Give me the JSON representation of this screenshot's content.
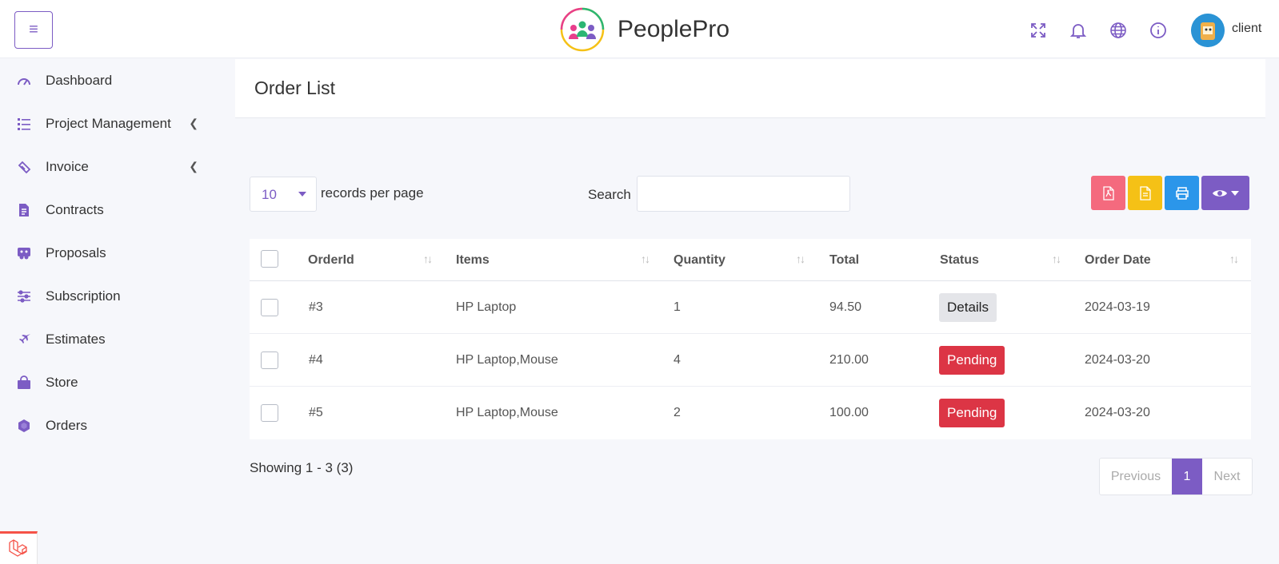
{
  "app": {
    "name": "PeoplePro",
    "user": "client"
  },
  "header": {
    "menu_icon": "hamburger-icon",
    "icons": [
      "fullscreen-icon",
      "bell-icon",
      "globe-icon",
      "info-icon"
    ]
  },
  "sidebar": {
    "items": [
      {
        "label": "Dashboard",
        "icon": "speedometer-icon",
        "expandable": false
      },
      {
        "label": "Project Management",
        "icon": "list-icon",
        "expandable": true
      },
      {
        "label": "Invoice",
        "icon": "ticket-icon",
        "expandable": true
      },
      {
        "label": "Contracts",
        "icon": "document-icon",
        "expandable": false
      },
      {
        "label": "Proposals",
        "icon": "proposal-icon",
        "expandable": false
      },
      {
        "label": "Subscription",
        "icon": "sliders-icon",
        "expandable": false
      },
      {
        "label": "Estimates",
        "icon": "plane-icon",
        "expandable": false
      },
      {
        "label": "Store",
        "icon": "shopping-bag-icon",
        "expandable": false
      },
      {
        "label": "Orders",
        "icon": "cube-icon",
        "expandable": false
      }
    ]
  },
  "page": {
    "title": "Order List"
  },
  "controls": {
    "per_page_value": "10",
    "per_page_label": "records per page",
    "search_label": "Search",
    "search_value": ""
  },
  "table": {
    "headers": [
      "OrderId",
      "Items",
      "Quantity",
      "Total",
      "Status",
      "Order Date"
    ],
    "rows": [
      {
        "order_id": "#3",
        "items": "HP Laptop",
        "quantity": "1",
        "total": "94.50",
        "status": "Details",
        "status_color": "#e4e5e9",
        "date": "2024-03-19"
      },
      {
        "order_id": "#4",
        "items": "HP Laptop,Mouse",
        "quantity": "4",
        "total": "210.00",
        "status": "Pending",
        "status_color": "#dc3545",
        "date": "2024-03-20"
      },
      {
        "order_id": "#5",
        "items": "HP Laptop,Mouse",
        "quantity": "2",
        "total": "100.00",
        "status": "Pending",
        "status_color": "#dc3545",
        "date": "2024-03-20"
      }
    ]
  },
  "footer": {
    "showing": "Showing 1 - 3 (3)",
    "prev": "Previous",
    "current_page": "1",
    "next": "Next"
  },
  "colors": {
    "accent": "#7c5cc4",
    "pdf": "#f46a7e",
    "csv": "#f5c116",
    "print": "#2b96ea",
    "danger": "#dc3545"
  }
}
